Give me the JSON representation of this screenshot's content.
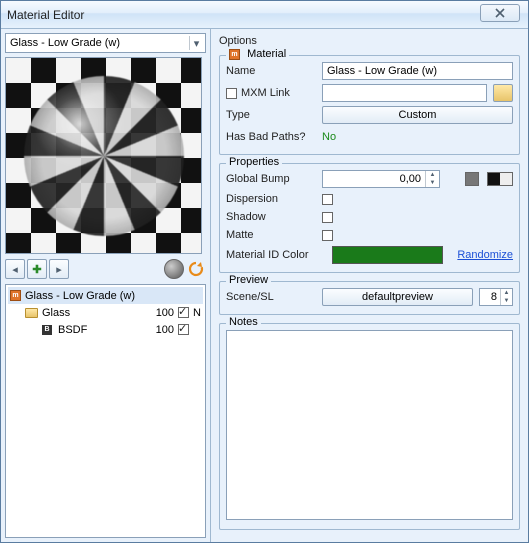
{
  "window": {
    "title": "Material Editor"
  },
  "left": {
    "material_dropdown": "Glass - Low Grade (w)",
    "tree": {
      "root": {
        "label": "Glass - Low Grade (w)"
      },
      "child1": {
        "label": "Glass",
        "value": "100",
        "nflag": "N"
      },
      "child2": {
        "label": "BSDF",
        "value": "100"
      }
    }
  },
  "right": {
    "options_title": "Options",
    "material_legend": "Material",
    "name_label": "Name",
    "name_value": "Glass - Low Grade (w)",
    "mxm_label": "MXM Link",
    "mxm_value": "",
    "type_label": "Type",
    "type_value": "Custom",
    "badpaths_label": "Has Bad Paths?",
    "badpaths_value": "No",
    "props_legend": "Properties",
    "globalbump_label": "Global Bump",
    "globalbump_value": "0,00",
    "dispersion_label": "Dispersion",
    "shadow_label": "Shadow",
    "matte_label": "Matte",
    "matid_label": "Material ID Color",
    "randomize": "Randomize",
    "preview_legend": "Preview",
    "scene_label": "Scene/SL",
    "scene_value": "defaultpreview",
    "scene_num": "8",
    "notes_legend": "Notes"
  }
}
